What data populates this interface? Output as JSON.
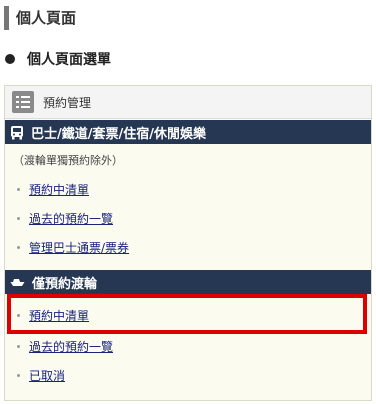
{
  "page": {
    "title": "個人頁面"
  },
  "section": {
    "title": "個人頁面選單"
  },
  "menu": {
    "header": "預約管理",
    "categories": [
      {
        "label": "巴士/鐵道/套票/住宿/休閒娛樂",
        "icon": "bus-icon",
        "note": "（渡輪單獨預約除外）",
        "items": [
          "預約中清單",
          "過去的預約一覽",
          "管理巴士通票/票券"
        ]
      },
      {
        "label": "僅預約渡輪",
        "icon": "ship-icon",
        "items": [
          "預約中清單",
          "過去的預約一覽",
          "已取消"
        ]
      }
    ]
  },
  "colors": {
    "category_bar": "#263753",
    "highlight_border": "#dd0000",
    "link": "#1a237e",
    "box_background": "#fbfbf0"
  }
}
